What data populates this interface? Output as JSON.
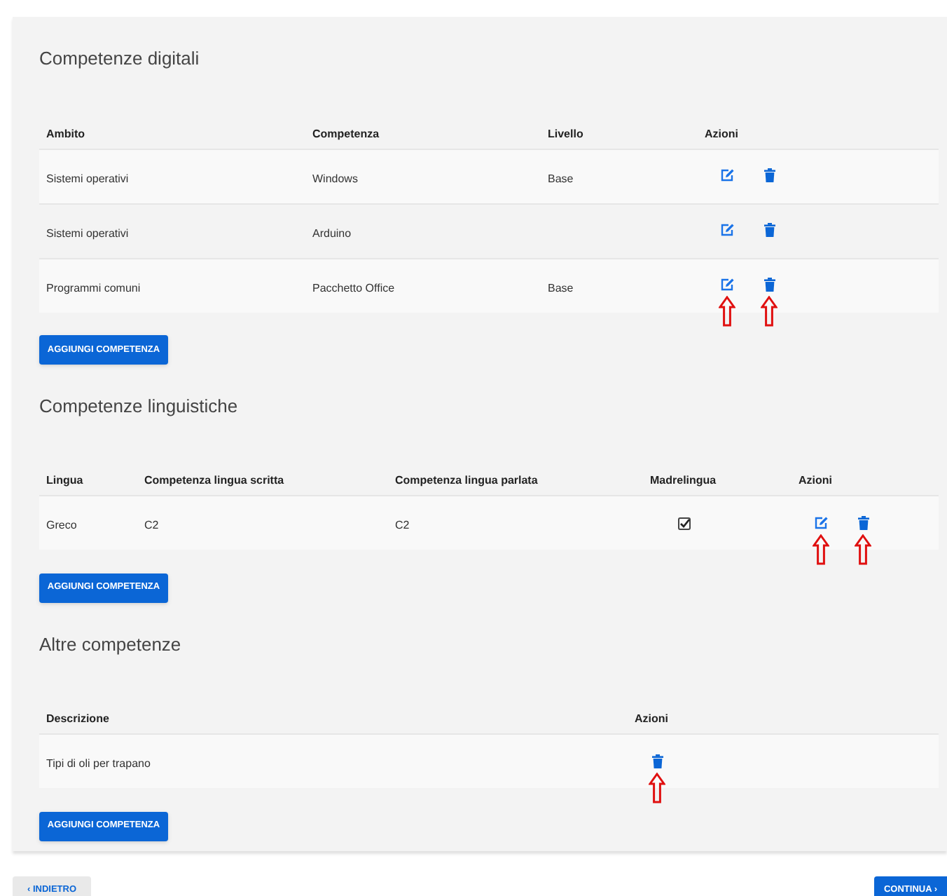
{
  "sections": [
    {
      "title": "Competenze digitali",
      "columns": [
        "Ambito",
        "Competenza",
        "Livello",
        "Azioni"
      ],
      "rows": [
        {
          "cells": [
            "Sistemi operativi",
            "Windows",
            "Base"
          ],
          "actions": [
            {
              "kind": "edit",
              "marked": false
            },
            {
              "kind": "delete",
              "marked": false
            }
          ]
        },
        {
          "cells": [
            "Sistemi operativi",
            "Arduino",
            ""
          ],
          "actions": [
            {
              "kind": "edit",
              "marked": false
            },
            {
              "kind": "delete",
              "marked": false
            }
          ]
        },
        {
          "cells": [
            "Programmi comuni",
            "Pacchetto Office",
            "Base"
          ],
          "actions": [
            {
              "kind": "edit",
              "marked": true
            },
            {
              "kind": "delete",
              "marked": true
            }
          ]
        }
      ],
      "button": "AGGIUNGI COMPETENZA"
    },
    {
      "title": "Competenze linguistiche",
      "columns": [
        "Lingua",
        "Competenza lingua scritta",
        "Competenza lingua parlata",
        "Madrelingua",
        "Azioni"
      ],
      "rows": [
        {
          "cells": [
            "Greco",
            "C2",
            "C2"
          ],
          "native": true,
          "actions": [
            {
              "kind": "edit",
              "marked": true
            },
            {
              "kind": "delete",
              "marked": true
            }
          ]
        }
      ],
      "button": "AGGIUNGI COMPETENZA"
    },
    {
      "title": "Altre competenze",
      "columns": [
        "Descrizione",
        "Azioni"
      ],
      "rows": [
        {
          "cells": [
            "Tipi di oli per trapano"
          ],
          "actions": [
            {
              "kind": "delete",
              "marked": true
            }
          ]
        }
      ],
      "button": "AGGIUNGI COMPETENZA"
    }
  ],
  "back_button": "‹ INDIETRO",
  "next_button": "CONTINUA ›"
}
